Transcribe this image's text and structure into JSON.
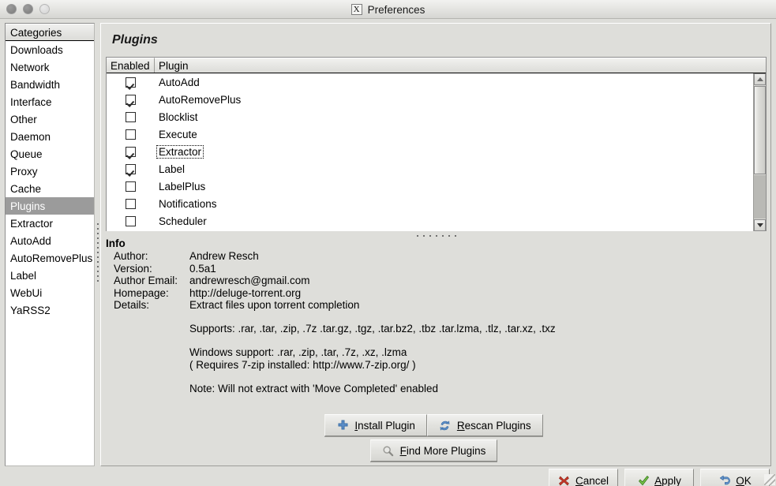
{
  "window": {
    "title": "Preferences",
    "title_icon": "x-logo-icon",
    "controls": [
      "close-button",
      "minimize-button",
      "maximize-button"
    ]
  },
  "sidebar": {
    "header": "Categories",
    "selected": "Plugins",
    "items": [
      "Downloads",
      "Network",
      "Bandwidth",
      "Interface",
      "Other",
      "Daemon",
      "Queue",
      "Proxy",
      "Cache",
      "Plugins",
      "Extractor",
      "AutoAdd",
      "AutoRemovePlus",
      "Label",
      "WebUi",
      "YaRSS2"
    ]
  },
  "page": {
    "title": "Plugins"
  },
  "plugin_list": {
    "columns": [
      "Enabled",
      "Plugin"
    ],
    "rows": [
      {
        "name": "AutoAdd",
        "enabled": true,
        "focused": false
      },
      {
        "name": "AutoRemovePlus",
        "enabled": true,
        "focused": false
      },
      {
        "name": "Blocklist",
        "enabled": false,
        "focused": false
      },
      {
        "name": "Execute",
        "enabled": false,
        "focused": false
      },
      {
        "name": "Extractor",
        "enabled": true,
        "focused": true
      },
      {
        "name": "Label",
        "enabled": true,
        "focused": false
      },
      {
        "name": "LabelPlus",
        "enabled": false,
        "focused": false
      },
      {
        "name": "Notifications",
        "enabled": false,
        "focused": false
      },
      {
        "name": "Scheduler",
        "enabled": false,
        "focused": false
      }
    ]
  },
  "info": {
    "title": "Info",
    "fields": [
      {
        "key": "Author:",
        "value": "Andrew Resch"
      },
      {
        "key": "Version:",
        "value": "0.5a1"
      },
      {
        "key": "Author Email:",
        "value": "andrewresch@gmail.com"
      },
      {
        "key": "Homepage:",
        "value": "http://deluge-torrent.org"
      },
      {
        "key": "Details:",
        "value": "Extract files upon torrent completion"
      }
    ],
    "details_paragraphs": [
      "Supports: .rar, .tar, .zip, .7z .tar.gz, .tgz, .tar.bz2, .tbz .tar.lzma, .tlz, .tar.xz, .txz",
      "Windows support: .rar, .zip, .tar, .7z, .xz, .lzma\n( Requires 7-zip installed: http://www.7-zip.org/ )",
      "Note: Will not extract with 'Move Completed' enabled"
    ]
  },
  "plugin_actions": [
    {
      "label": "Install Plugin",
      "mnemonic": "I",
      "icon": "plus-icon"
    },
    {
      "label": "Rescan Plugins",
      "mnemonic": "R",
      "icon": "refresh-icon"
    },
    {
      "label": "Find More Plugins",
      "mnemonic": "F",
      "icon": "magnifier-icon"
    }
  ],
  "dialog_actions": [
    {
      "label": "Cancel",
      "mnemonic": "C",
      "icon": "cancel-x-icon"
    },
    {
      "label": "Apply",
      "mnemonic": "A",
      "icon": "check-icon"
    },
    {
      "label": "OK",
      "mnemonic": "O",
      "icon": "back-arrow-icon"
    }
  ],
  "colors": {
    "window_bg": "#dededa",
    "selection": "#9b9b9b",
    "list_bg": "#ffffff",
    "accent_blue": "#4a79b5",
    "cancel_red": "#c0392b",
    "apply_green": "#5aa察"
  }
}
